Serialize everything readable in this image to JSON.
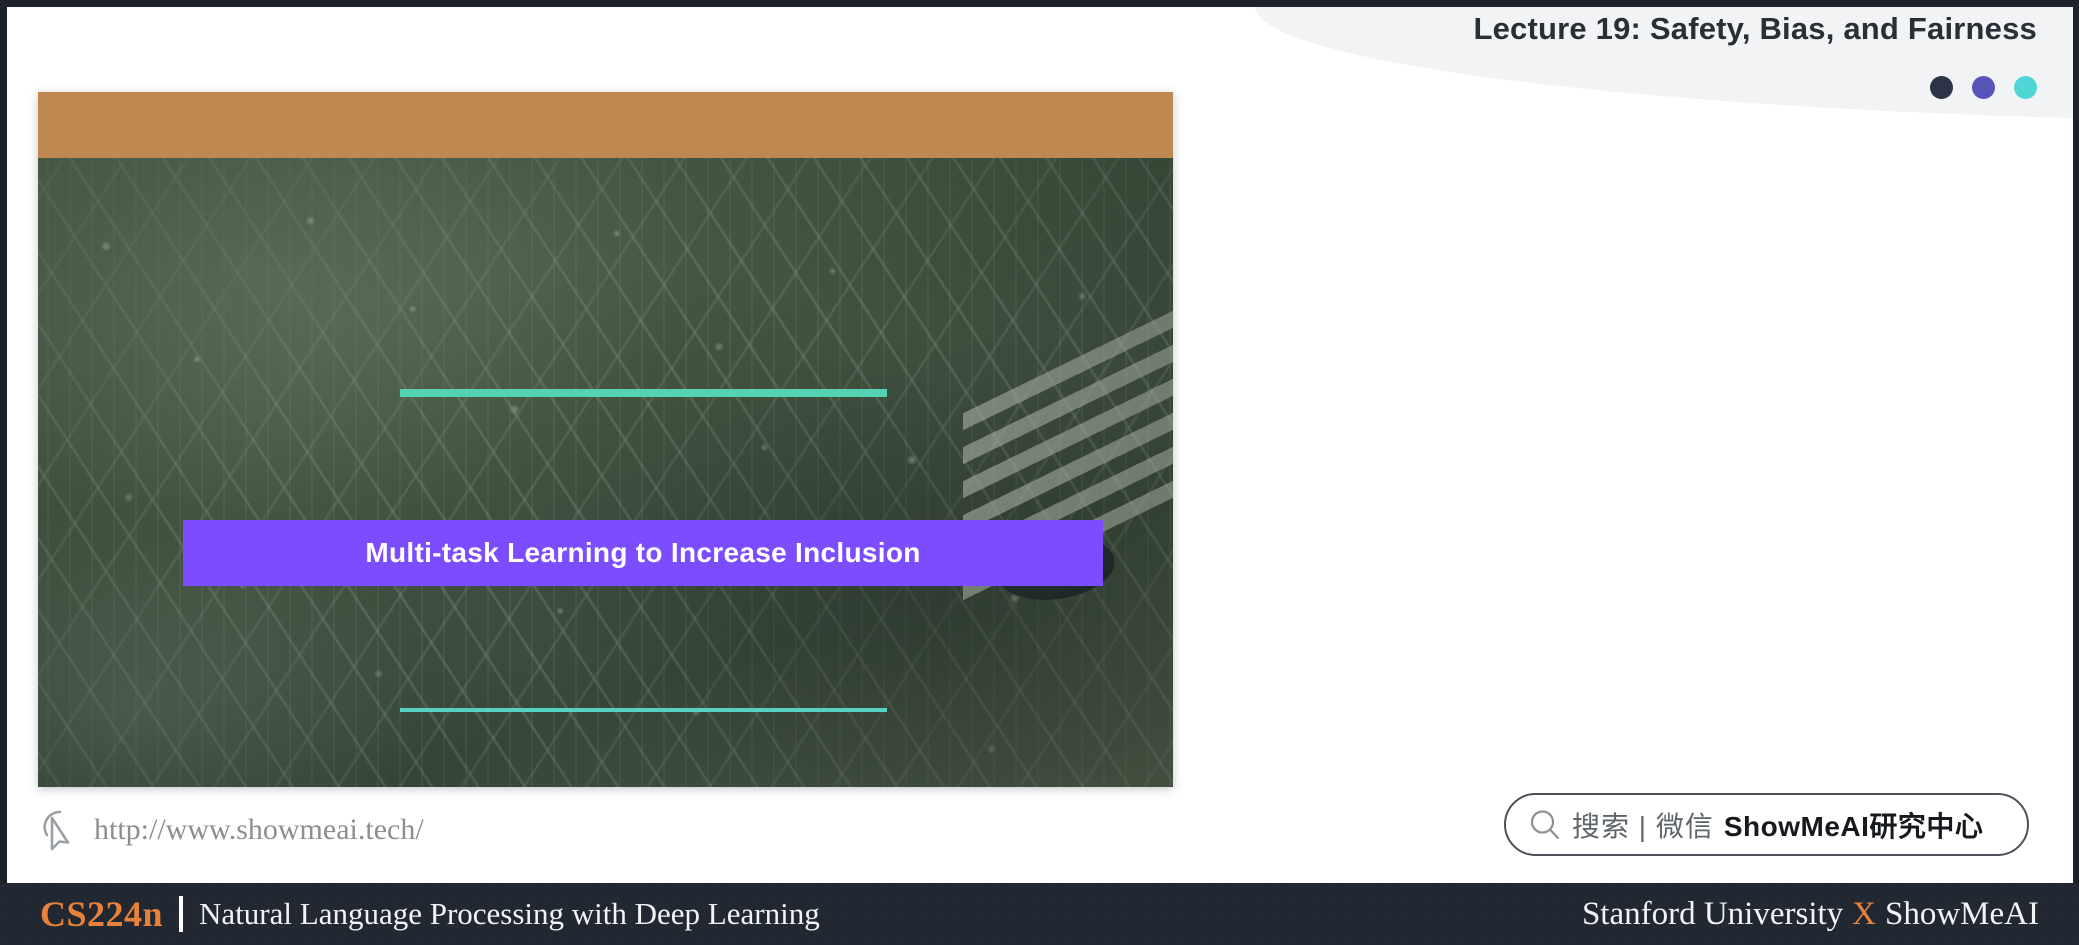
{
  "header": {
    "title": "Lecture 19: Safety, Bias, and Fairness",
    "dots": [
      {
        "name": "dot-dark-navy",
        "color": "#2d3347"
      },
      {
        "name": "dot-purple",
        "color": "#5754b9"
      },
      {
        "name": "dot-teal",
        "color": "#4fd7d7"
      }
    ]
  },
  "slide": {
    "banner_color": "#bf8851",
    "title": "Multi-task Learning to Increase Inclusion",
    "title_banner_color": "#7c4dff",
    "rule_color": "#54d3b3",
    "background_description": "circuit-board-photo"
  },
  "url_row": {
    "icon": "cursor-pointer-icon",
    "text": "http://www.showmeai.tech/"
  },
  "search_pill": {
    "icon": "search-icon",
    "grey_text": "搜索 | 微信",
    "bold_text": "ShowMeAI研究中心"
  },
  "footer": {
    "course_code": "CS224n",
    "course_name": "Natural Language Processing with Deep Learning",
    "affiliation_left": "Stanford University",
    "affiliation_sep": "X",
    "affiliation_right": "ShowMeAI",
    "accent_color": "#e8823a",
    "background_color": "#222832"
  }
}
